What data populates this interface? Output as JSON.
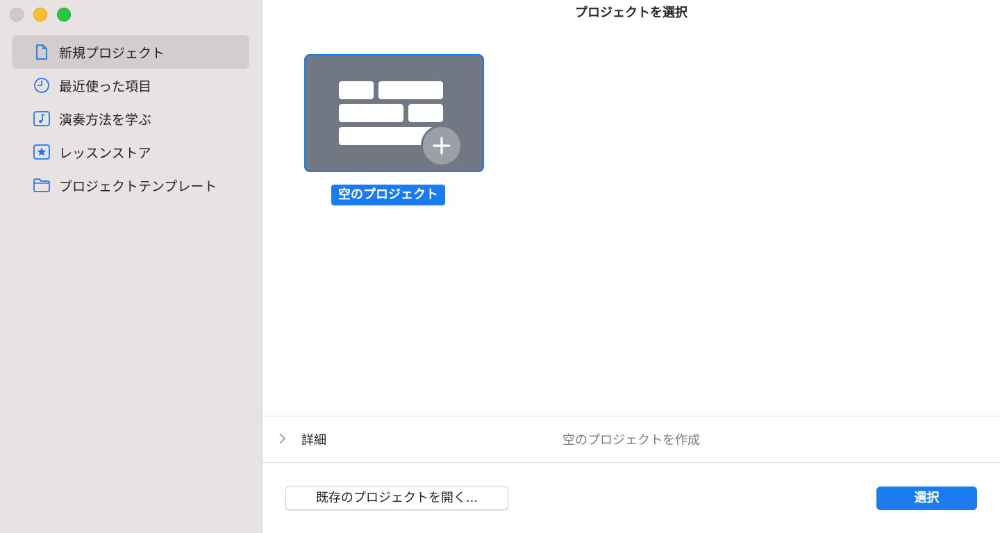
{
  "window": {
    "title": "プロジェクトを選択"
  },
  "sidebar": {
    "items": [
      {
        "label": "新規プロジェクト",
        "icon": "document-icon",
        "selected": true
      },
      {
        "label": "最近使った項目",
        "icon": "clock-icon",
        "selected": false
      },
      {
        "label": "演奏方法を学ぶ",
        "icon": "music-note-icon",
        "selected": false
      },
      {
        "label": "レッスンストア",
        "icon": "star-icon",
        "selected": false
      },
      {
        "label": "プロジェクトテンプレート",
        "icon": "folder-icon",
        "selected": false
      }
    ]
  },
  "templates": [
    {
      "label": "空のプロジェクト",
      "icon": "empty-project-icon",
      "selected": true
    }
  ],
  "details": {
    "label": "詳細",
    "description": "空のプロジェクトを作成"
  },
  "footer": {
    "open_existing_label": "既存のプロジェクトを開く...",
    "select_label": "選択"
  },
  "colors": {
    "accent": "#1a7cf0",
    "sidebar_bg": "#e8e2e2",
    "tile_bg": "#717883"
  }
}
